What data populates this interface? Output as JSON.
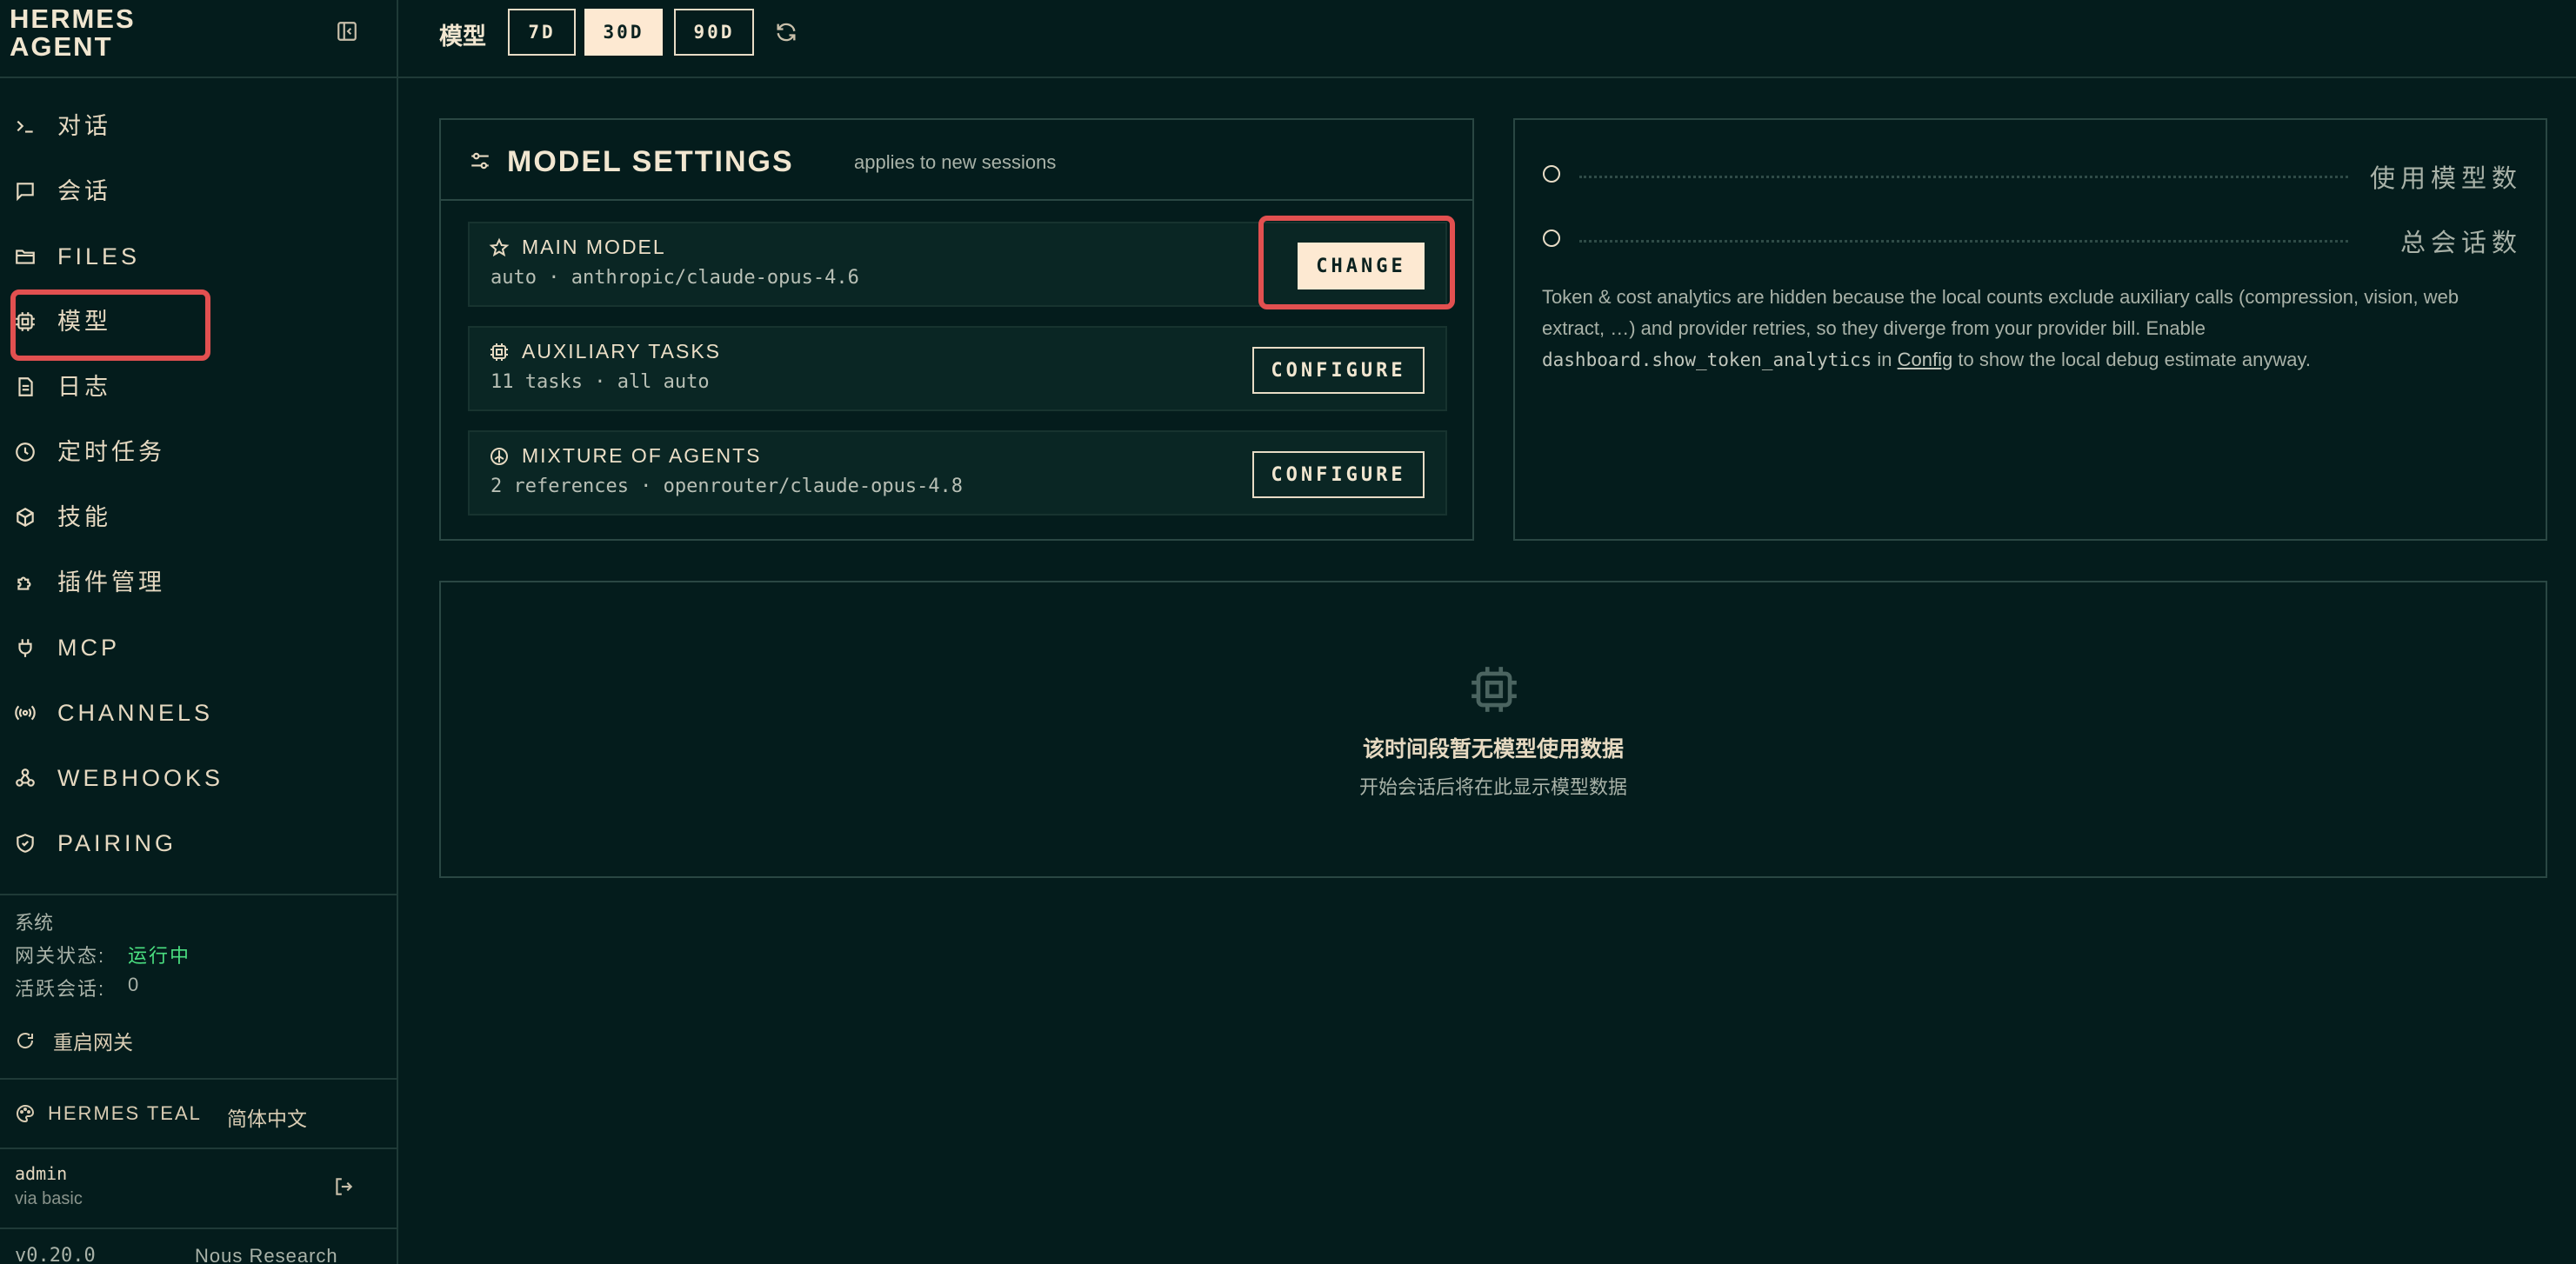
{
  "brand": {
    "line1": "HERMES",
    "line2": "AGENT"
  },
  "sidebar": {
    "items": [
      {
        "label": "对话",
        "icon": "terminal-icon"
      },
      {
        "label": "会话",
        "icon": "chat-icon"
      },
      {
        "label": "FILES",
        "icon": "folder-icon"
      },
      {
        "label": "模型",
        "icon": "chip-icon",
        "active": true
      },
      {
        "label": "日志",
        "icon": "document-icon"
      },
      {
        "label": "定时任务",
        "icon": "clock-icon"
      },
      {
        "label": "技能",
        "icon": "package-icon"
      },
      {
        "label": "插件管理",
        "icon": "puzzle-icon"
      },
      {
        "label": "MCP",
        "icon": "plug-icon"
      },
      {
        "label": "CHANNELS",
        "icon": "radio-icon"
      },
      {
        "label": "WEBHOOKS",
        "icon": "webhook-icon"
      },
      {
        "label": "PAIRING",
        "icon": "shield-icon"
      }
    ],
    "system": {
      "title": "系统",
      "gateway_label": "网关状态:",
      "gateway_value": "运行中",
      "sessions_label": "活跃会话:",
      "sessions_value": "0",
      "restart_label": "重启网关"
    },
    "theme_label": "HERMES TEAL",
    "language_label": "简体中文",
    "user": {
      "name": "admin",
      "via": "via basic"
    },
    "version": "v0.20.0",
    "vendor": "Nous Research"
  },
  "topbar": {
    "title": "模型",
    "ranges": [
      "7D",
      "30D",
      "90D"
    ],
    "active_range": "30D"
  },
  "model_settings": {
    "title": "MODEL SETTINGS",
    "subtitle": "applies to new sessions",
    "rows": [
      {
        "name": "MAIN MODEL",
        "value": "auto · anthropic/claude-opus-4.6",
        "button": "CHANGE",
        "icon": "star-icon"
      },
      {
        "name": "AUXILIARY TASKS",
        "value": "11 tasks · all auto",
        "button": "CONFIGURE",
        "icon": "chip-icon"
      },
      {
        "name": "MIXTURE OF AGENTS",
        "value": "2 references · openrouter/claude-opus-4.8",
        "button": "CONFIGURE",
        "icon": "moa-icon"
      }
    ]
  },
  "stats": {
    "models_used_label": "使用模型数",
    "total_sessions_label": "总会话数",
    "note_part1": "Token & cost analytics are hidden because the local counts exclude auxiliary calls (compression, vision, web extract, …) and provider retries, so they diverge from your provider bill. Enable ",
    "note_code": "dashboard.show_token_analytics",
    "note_part2": " in ",
    "note_link": "Config",
    "note_part3": " to show the local debug estimate anyway."
  },
  "empty_state": {
    "title": "该时间段暂无模型使用数据",
    "subtitle": "开始会话后将在此显示模型数据"
  },
  "colors": {
    "background": "#041c1c",
    "accent_button": "#fde9d2",
    "highlight": "#e25050",
    "status_ok": "#4ade80"
  }
}
